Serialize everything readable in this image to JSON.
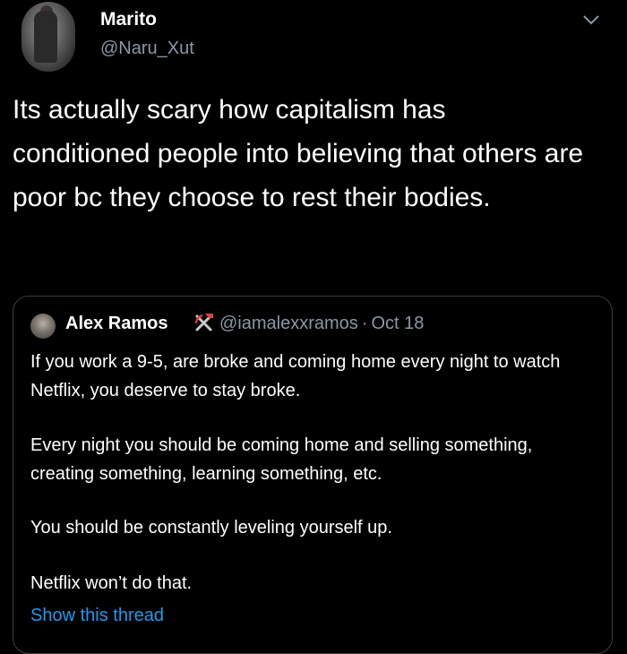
{
  "tweet": {
    "display_name": "Marito",
    "handle": "@Naru_Xut",
    "text": "Its actually scary how capitalism has conditioned people into believing that others are poor bc they choose to rest their bodies.",
    "more_icon": "chevron-down-icon"
  },
  "quoted": {
    "author": "Alex Ramos",
    "badge_icon": "hammer-and-pick-icon",
    "handle": "@iamalexxramos",
    "separator": "·",
    "date": "Oct 18",
    "paragraphs": [
      "If you work a 9-5, are broke and coming home every night to watch Netflix, you deserve to stay broke.",
      "Every night you should be coming home and selling something, creating something, learning something, etc.",
      "You should be constantly leveling yourself up.",
      "Netflix won’t do that."
    ],
    "show_thread": "Show this thread"
  },
  "colors": {
    "background": "#000000",
    "text": "#ffffff",
    "secondary": "#8b98a5",
    "link": "#1d9bf0",
    "border": "#3a3f44"
  }
}
